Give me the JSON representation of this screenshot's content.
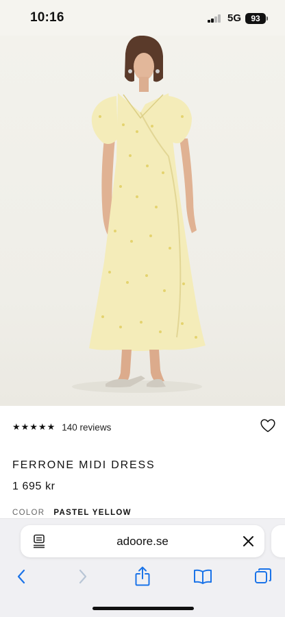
{
  "status_bar": {
    "time": "10:16",
    "network": "5G",
    "battery": "93"
  },
  "product": {
    "rating_stars": "★★★★★",
    "reviews": "140 reviews",
    "title": "FERRONE MIDI DRESS",
    "price": "1 695 kr",
    "color_label": "COLOR",
    "color_value": "PASTEL YELLOW",
    "image_alt": "Model wearing pastel yellow wrap midi dress",
    "dress_color": "#f4ecb9"
  },
  "browser": {
    "url": "adoore.se"
  },
  "icons": {
    "wishlist": "heart-icon",
    "reader": "reader-icon",
    "close": "close-icon",
    "back": "chevron-left-icon",
    "forward": "chevron-right-icon",
    "share": "share-icon",
    "bookmarks": "book-icon",
    "tabs": "tabs-icon"
  },
  "colors": {
    "accent": "#1a73e8",
    "disabled": "#b9c6d6",
    "background": "#f0f0f3"
  }
}
